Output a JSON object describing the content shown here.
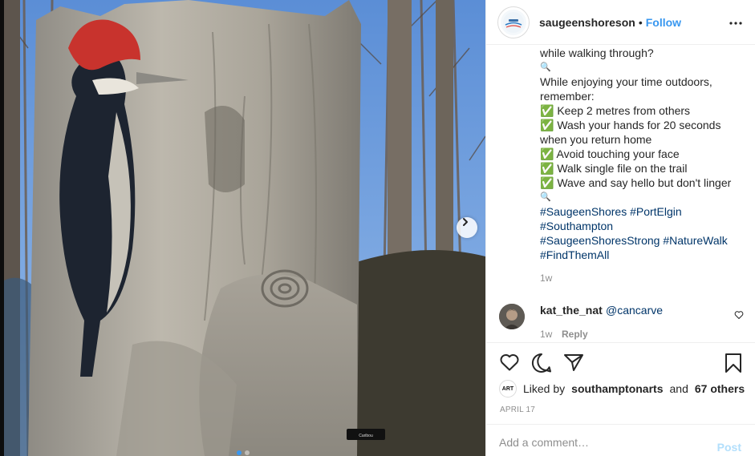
{
  "post": {
    "username": "saugeenshoreson",
    "separator": "•",
    "follow_label": "Follow",
    "more_label": "•••",
    "avatar_text": "Saugeen Shores",
    "image_sign_text": "Caribou"
  },
  "caption": {
    "lines": [
      "while walking through?",
      "🔍",
      "While enjoying your time outdoors, remember:",
      "✅ Keep 2 metres from others",
      "✅ Wash your hands for 20 seconds when you return home",
      "✅ Avoid touching your face",
      "✅ Walk single file on the trail",
      "✅ Wave and say hello but don't linger",
      "🔍"
    ],
    "hashtags": [
      "#SaugeenShores",
      "#PortElgin",
      "#Southampton",
      "#SaugeenShoresStrong",
      "#NatureWalk",
      "#FindThemAll"
    ],
    "time": "1w"
  },
  "comment": {
    "username": "kat_the_nat",
    "mention": "@cancarve",
    "time": "1w",
    "reply_label": "Reply"
  },
  "actions": {
    "liked_by_label": "Liked by",
    "liked_user": "southamptonarts",
    "and_label": "and",
    "others_label": "67 others",
    "badge_text": "ART",
    "date": "APRIL 17"
  },
  "add_comment": {
    "placeholder": "Add a comment…",
    "post_label": "Post"
  },
  "carousel": {
    "dot_count": 2,
    "active_index": 0
  },
  "colors": {
    "link_blue": "#3897f0",
    "hashtag_blue": "#003569",
    "muted": "#8e8e8e",
    "post_disabled": "#b2dffc"
  }
}
